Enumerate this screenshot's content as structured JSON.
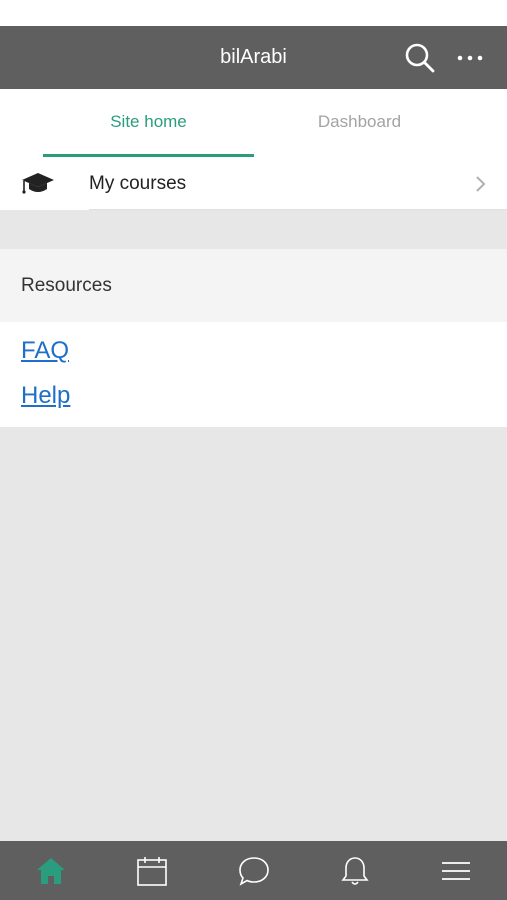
{
  "header": {
    "title": "bilArabi",
    "search_icon": "search-icon",
    "more_icon": "more-icon"
  },
  "tabs": [
    {
      "label": "Site home",
      "active": true
    },
    {
      "label": "Dashboard",
      "active": false
    }
  ],
  "courses": {
    "label": "My courses",
    "icon": "graduation-cap-icon",
    "chevron": "chevron-right-icon"
  },
  "resources": {
    "title": "Resources",
    "links": [
      {
        "label": "FAQ"
      },
      {
        "label": "Help"
      }
    ]
  },
  "bottom_nav": {
    "items": [
      {
        "icon": "home-icon",
        "active": true
      },
      {
        "icon": "calendar-icon",
        "active": false
      },
      {
        "icon": "messages-icon",
        "active": false
      },
      {
        "icon": "notifications-icon",
        "active": false
      },
      {
        "icon": "menu-icon",
        "active": false
      }
    ]
  },
  "colors": {
    "accent": "#2a9d7e",
    "bar": "#5f5f5f",
    "link": "#1e6fc8",
    "background": "#e7e7e7"
  }
}
